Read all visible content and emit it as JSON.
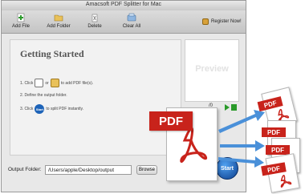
{
  "window": {
    "title": "Amacsoft PDF Splitter for Mac"
  },
  "toolbar": {
    "add_file": "Add File",
    "add_folder": "Add Folder",
    "delete": "Delete",
    "clear_all": "Clear All",
    "register": "Register Now!"
  },
  "main": {
    "title": "Getting Started",
    "step1_prefix": "1. Click",
    "step1_or": "or",
    "step1_suffix": "to add PDF file(s).",
    "step2": "2. Define the output folder.",
    "step3_prefix": "3. Click",
    "step3_suffix": "to split PDF instantly.",
    "start_mini": "Start"
  },
  "preview": {
    "label": "Preview",
    "page_fragment": "/0"
  },
  "output": {
    "label": "Output Folder:",
    "path": "/Users/apple/Desktop/output",
    "browse": "Browse",
    "start": "Start"
  },
  "promo": {
    "big_label": "PDF",
    "small_labels": [
      "PDF",
      "PDF",
      "PDF",
      "PDF"
    ],
    "arrow_color": "#4a90d9",
    "accent": "#c8231b"
  }
}
